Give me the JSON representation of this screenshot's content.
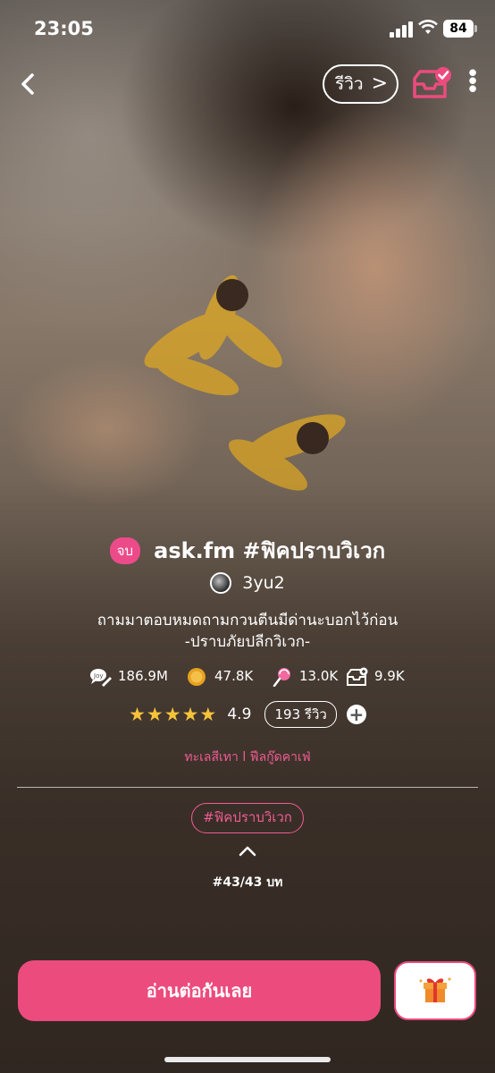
{
  "status_bar": {
    "time": "23:05",
    "battery": "84"
  },
  "nav": {
    "back_label": "<",
    "review_label": "รีวิว",
    "review_chevron": ">"
  },
  "story": {
    "status_badge": "จบ",
    "title": "ask.fm #ฟิคปราบวิเวก",
    "author": "3yu2",
    "description_line1": "ถามมาตอบหมดถามกวนตีนมีด่านะบอกไว้ก่อน",
    "description_line2": "-ปราบภัยปลีกวิเวก-"
  },
  "stats": {
    "views": "186.9M",
    "coins": "47.8K",
    "candy": "13.0K",
    "shelf": "9.9K"
  },
  "rating": {
    "stars": "★★★★★",
    "value": "4.9",
    "review_count": "193 รีวิว",
    "add_label": "+"
  },
  "genre": "ทะเลสีเทา l ฟีลกู๊ดคาเฟ่",
  "hashtag": "#ฟิคปราบวิเวก",
  "chapter": "#43/43 บท",
  "read_button": "อ่านต่อกันเลย",
  "colors": {
    "accent": "#ec4b7e",
    "star": "#f6c33a"
  }
}
